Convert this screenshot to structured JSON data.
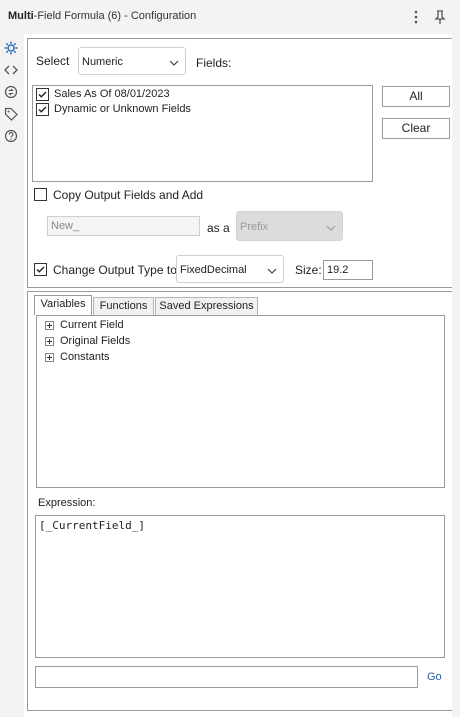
{
  "titlebar": {
    "title_bold": "Multi",
    "title_rest": "-Field Formula (6) - Configuration",
    "menu_icon": "more-vertical-icon",
    "pin_icon": "pin-icon"
  },
  "rail": {
    "icons": [
      "gear-icon",
      "code-brackets-icon",
      "shuffle-circle-icon",
      "tag-icon",
      "help-circle-icon"
    ]
  },
  "config": {
    "select_label": "Select",
    "type_select_value": "Numeric",
    "fields_label": "Fields:",
    "fields": [
      {
        "label": "Sales As Of 08/01/2023",
        "checked": true
      },
      {
        "label": "Dynamic or Unknown Fields",
        "checked": true
      }
    ],
    "all_button": "All",
    "clear_button": "Clear",
    "copy_output_label": "Copy Output Fields and Add",
    "copy_output_checked": false,
    "name_input_value": "New_",
    "as_a_label": "as a",
    "position_select_value": "Prefix",
    "change_type_label": "Change Output Type to",
    "change_type_checked": true,
    "output_type_value": "FixedDecimal",
    "size_label": "Size:",
    "size_value": "19.2"
  },
  "expression_panel": {
    "tabs": [
      {
        "label": "Variables",
        "active": true
      },
      {
        "label": "Functions",
        "active": false
      },
      {
        "label": "Saved Expressions",
        "active": false
      }
    ],
    "tree_items": [
      "Current Field",
      "Original Fields",
      "Constants"
    ],
    "expression_label": "Expression:",
    "expression_text": "[_CurrentField_]",
    "go_button": "Go"
  }
}
